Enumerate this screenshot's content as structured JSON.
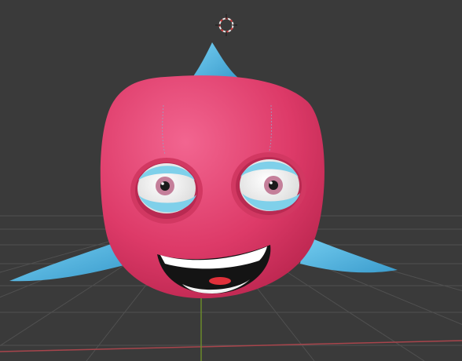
{
  "viewport": {
    "background_color": "#3a3a3a",
    "grid_line_color": "#505050",
    "x_axis_color": "#a8454c",
    "y_axis_color": "#6b8a2a"
  },
  "scene_objects": {
    "cursor": {
      "icon": "3d-cursor-icon"
    },
    "character": {
      "body_color": "#e0406a",
      "fin_color": "#52b9e0",
      "eye_lid_color": "#7fd0ea",
      "iris_color": "#c47f9a",
      "mouth_color": "#141414",
      "teeth_color": "#ffffff",
      "tongue_color": "#e0303a"
    }
  }
}
